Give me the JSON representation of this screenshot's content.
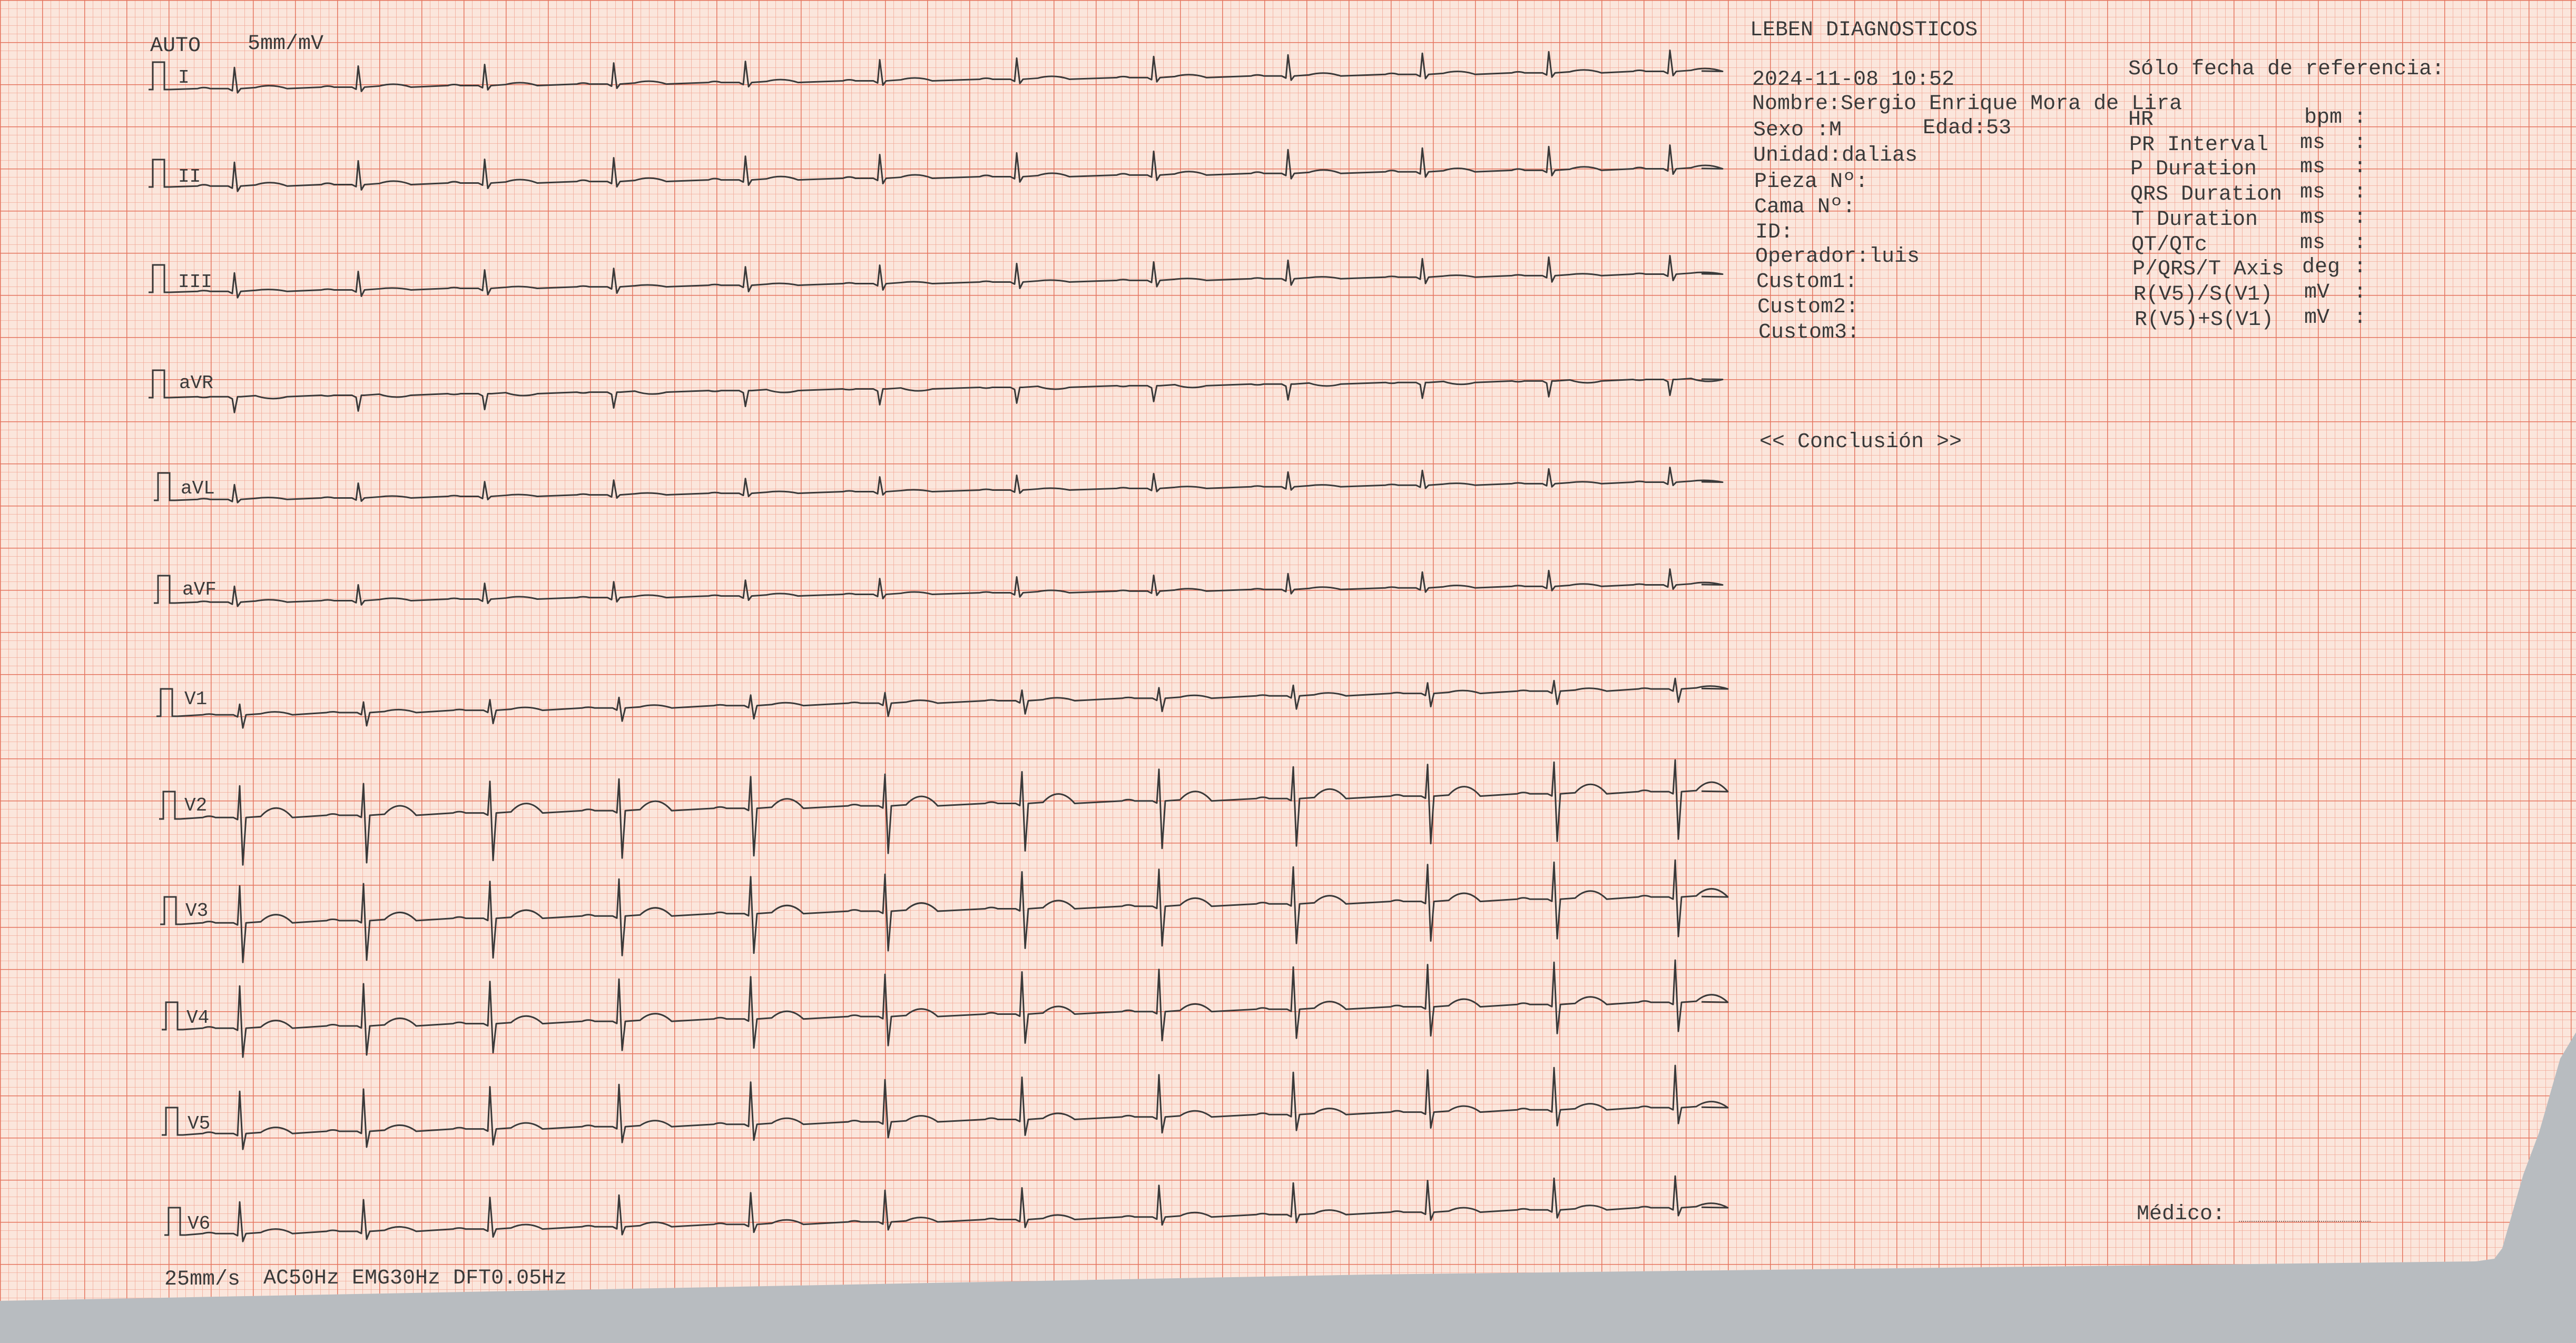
{
  "top_left": {
    "mode": "AUTO",
    "gain": "5mm/mV"
  },
  "bottom_left": {
    "speed": "25mm/s",
    "filters": "AC50Hz EMG30Hz DFT0.05Hz"
  },
  "header": {
    "company": "LEBEN DIAGNOSTICOS",
    "datetime": "2024-11-08 10:52",
    "reference_note": "Sólo fecha de referencia:"
  },
  "patient": {
    "nombre": "Nombre:Sergio Enrique Mora de Lira",
    "sexo": "Sexo :M",
    "edad": "Edad:53",
    "unidad": "Unidad:dalias",
    "pieza": "Pieza Nº:",
    "cama": "Cama Nº:",
    "id": "ID:",
    "operador": "Operador:luis",
    "custom1": "Custom1:",
    "custom2": "Custom2:",
    "custom3": "Custom3:"
  },
  "measurements": [
    {
      "name": "HR",
      "unit": "bpm",
      "value": ":"
    },
    {
      "name": "PR Interval",
      "unit": "ms",
      "value": ":"
    },
    {
      "name": "P Duration",
      "unit": "ms",
      "value": ":"
    },
    {
      "name": "QRS Duration",
      "unit": "ms",
      "value": ":"
    },
    {
      "name": "T Duration",
      "unit": "ms",
      "value": ":"
    },
    {
      "name": "QT/QTc",
      "unit": "ms",
      "value": ":"
    },
    {
      "name": "P/QRS/T Axis",
      "unit": "deg",
      "value": ":"
    },
    {
      "name": "R(V5)/S(V1)",
      "unit": "mV",
      "value": ":"
    },
    {
      "name": "R(V5)+S(V1)",
      "unit": "mV",
      "value": ":"
    }
  ],
  "conclusion": "<< Conclusión >>",
  "medico": "Médico:",
  "leads": [
    "I",
    "II",
    "III",
    "aVR",
    "aVL",
    "aVF",
    "V1",
    "V2",
    "V3",
    "V4",
    "V5",
    "V6"
  ],
  "colors": {
    "paper": "#fbe3d9",
    "grid_minor": "#f4b4a0",
    "grid_major": "#e8806a",
    "trace": "#3a3a3a"
  }
}
